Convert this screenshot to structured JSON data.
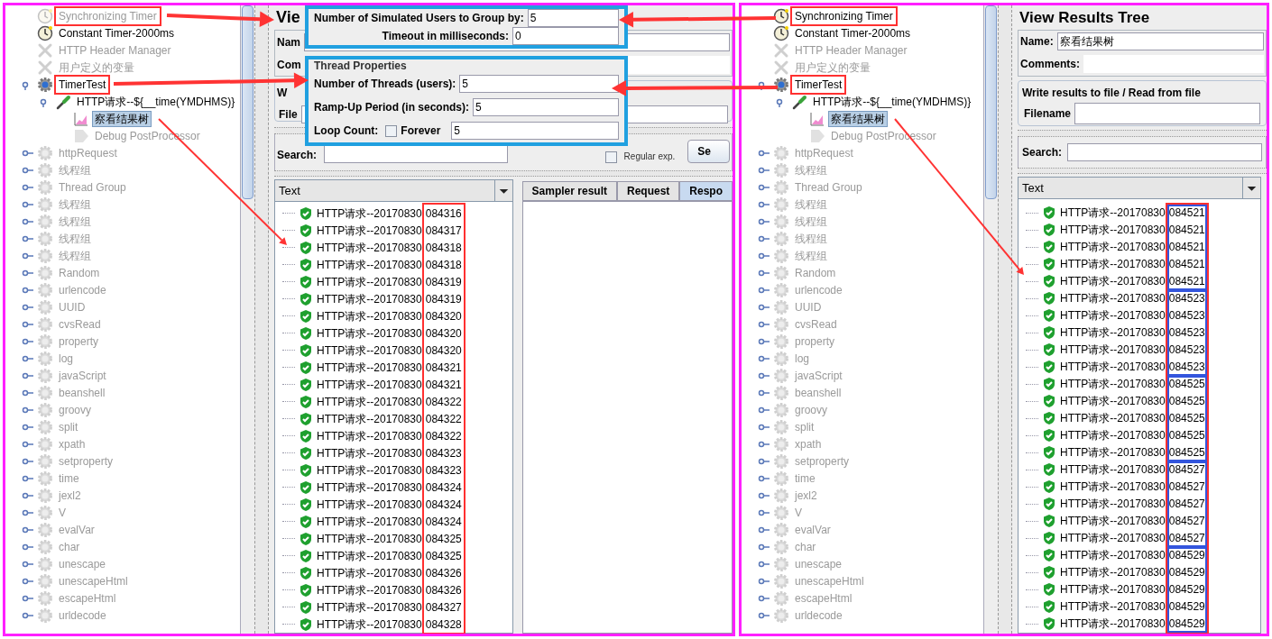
{
  "left_screenshot": {
    "tree": [
      {
        "label": "Synchronizing Timer",
        "kind": "timer",
        "selected": false,
        "disabled": true,
        "highlighted": true
      },
      {
        "label": "Constant Timer-2000ms",
        "kind": "timer",
        "selected": false,
        "disabled": false,
        "highlighted": false
      },
      {
        "label": "HTTP Header Manager",
        "kind": "config",
        "selected": false,
        "disabled": true,
        "highlighted": false
      },
      {
        "label": "用户定义的变量",
        "kind": "config",
        "selected": false,
        "disabled": true,
        "highlighted": false
      },
      {
        "label": "TimerTest",
        "kind": "thread-group",
        "expanded": true,
        "selected": false,
        "disabled": false,
        "highlighted": true,
        "children": [
          {
            "label": "HTTP请求--${__time(YMDHMS)}",
            "kind": "sampler",
            "expanded": true,
            "selected": false,
            "disabled": false,
            "highlighted": false,
            "children": [
              {
                "label": "察看结果树",
                "kind": "listener",
                "selected": true,
                "disabled": false,
                "highlighted": false
              },
              {
                "label": "Debug PostProcessor",
                "kind": "post-processor",
                "selected": false,
                "disabled": true,
                "highlighted": false
              }
            ]
          }
        ]
      },
      {
        "label": "httpRequest",
        "kind": "thread-group",
        "expanded": false,
        "selected": false,
        "disabled": true,
        "highlighted": false
      },
      {
        "label": "线程组",
        "kind": "thread-group",
        "expanded": false,
        "selected": false,
        "disabled": true,
        "highlighted": false
      },
      {
        "label": "Thread Group",
        "kind": "thread-group",
        "expanded": false,
        "selected": false,
        "disabled": true,
        "highlighted": false
      },
      {
        "label": "线程组",
        "kind": "thread-group",
        "expanded": false,
        "selected": false,
        "disabled": true,
        "highlighted": false
      },
      {
        "label": "线程组",
        "kind": "thread-group",
        "expanded": false,
        "selected": false,
        "disabled": true,
        "highlighted": false
      },
      {
        "label": "线程组",
        "kind": "thread-group",
        "expanded": false,
        "selected": false,
        "disabled": true,
        "highlighted": false
      },
      {
        "label": "线程组",
        "kind": "thread-group",
        "expanded": false,
        "selected": false,
        "disabled": true,
        "highlighted": false
      },
      {
        "label": "Random",
        "kind": "thread-group",
        "expanded": false,
        "selected": false,
        "disabled": true,
        "highlighted": false
      },
      {
        "label": "urlencode",
        "kind": "thread-group",
        "expanded": false,
        "selected": false,
        "disabled": true,
        "highlighted": false
      },
      {
        "label": "UUID",
        "kind": "thread-group",
        "expanded": false,
        "selected": false,
        "disabled": true,
        "highlighted": false
      },
      {
        "label": "cvsRead",
        "kind": "thread-group",
        "expanded": false,
        "selected": false,
        "disabled": true,
        "highlighted": false
      },
      {
        "label": "property",
        "kind": "thread-group",
        "expanded": false,
        "selected": false,
        "disabled": true,
        "highlighted": false
      },
      {
        "label": "log",
        "kind": "thread-group",
        "expanded": false,
        "selected": false,
        "disabled": true,
        "highlighted": false
      },
      {
        "label": "javaScript",
        "kind": "thread-group",
        "expanded": false,
        "selected": false,
        "disabled": true,
        "highlighted": false
      },
      {
        "label": "beanshell",
        "kind": "thread-group",
        "expanded": false,
        "selected": false,
        "disabled": true,
        "highlighted": false
      },
      {
        "label": "groovy",
        "kind": "thread-group",
        "expanded": false,
        "selected": false,
        "disabled": true,
        "highlighted": false
      },
      {
        "label": "split",
        "kind": "thread-group",
        "expanded": false,
        "selected": false,
        "disabled": true,
        "highlighted": false
      },
      {
        "label": "xpath",
        "kind": "thread-group",
        "expanded": false,
        "selected": false,
        "disabled": true,
        "highlighted": false
      },
      {
        "label": "setproperty",
        "kind": "thread-group",
        "expanded": false,
        "selected": false,
        "disabled": true,
        "highlighted": false
      },
      {
        "label": "time",
        "kind": "thread-group",
        "expanded": false,
        "selected": false,
        "disabled": true,
        "highlighted": false
      },
      {
        "label": "jexl2",
        "kind": "thread-group",
        "expanded": false,
        "selected": false,
        "disabled": true,
        "highlighted": false
      },
      {
        "label": "V",
        "kind": "thread-group",
        "expanded": false,
        "selected": false,
        "disabled": true,
        "highlighted": false
      },
      {
        "label": "evalVar",
        "kind": "thread-group",
        "expanded": false,
        "selected": false,
        "disabled": true,
        "highlighted": false
      },
      {
        "label": "char",
        "kind": "thread-group",
        "expanded": false,
        "selected": false,
        "disabled": true,
        "highlighted": false
      },
      {
        "label": "unescape",
        "kind": "thread-group",
        "expanded": false,
        "selected": false,
        "disabled": true,
        "highlighted": false
      },
      {
        "label": "unescapeHtml",
        "kind": "thread-group",
        "expanded": false,
        "selected": false,
        "disabled": true,
        "highlighted": false
      },
      {
        "label": "escapeHtml",
        "kind": "thread-group",
        "expanded": false,
        "selected": false,
        "disabled": true,
        "highlighted": false
      },
      {
        "label": "urldecode",
        "kind": "thread-group",
        "expanded": false,
        "selected": false,
        "disabled": true,
        "highlighted": false
      }
    ],
    "results_panel": {
      "title": "Vie",
      "name_label": "Nam",
      "comments_label": "Com",
      "file_group_label": "W",
      "filename_label": "File",
      "search_label": "Search:",
      "regex_label": "Regular exp.",
      "regex_checked": false,
      "search_button": "Se",
      "column_header": "Text",
      "tabs": [
        {
          "label": "Sampler result",
          "selected": false
        },
        {
          "label": "Request",
          "selected": false
        },
        {
          "label": "Respo",
          "selected": true
        }
      ],
      "rows": [
        {
          "label": "HTTP请求--20170830",
          "time": "084316"
        },
        {
          "label": "HTTP请求--20170830",
          "time": "084317"
        },
        {
          "label": "HTTP请求--20170830",
          "time": "084318"
        },
        {
          "label": "HTTP请求--20170830",
          "time": "084318"
        },
        {
          "label": "HTTP请求--20170830",
          "time": "084319"
        },
        {
          "label": "HTTP请求--20170830",
          "time": "084319"
        },
        {
          "label": "HTTP请求--20170830",
          "time": "084320"
        },
        {
          "label": "HTTP请求--20170830",
          "time": "084320"
        },
        {
          "label": "HTTP请求--20170830",
          "time": "084320"
        },
        {
          "label": "HTTP请求--20170830",
          "time": "084321"
        },
        {
          "label": "HTTP请求--20170830",
          "time": "084321"
        },
        {
          "label": "HTTP请求--20170830",
          "time": "084322"
        },
        {
          "label": "HTTP请求--20170830",
          "time": "084322"
        },
        {
          "label": "HTTP请求--20170830",
          "time": "084322"
        },
        {
          "label": "HTTP请求--20170830",
          "time": "084323"
        },
        {
          "label": "HTTP请求--20170830",
          "time": "084323"
        },
        {
          "label": "HTTP请求--20170830",
          "time": "084324"
        },
        {
          "label": "HTTP请求--20170830",
          "time": "084324"
        },
        {
          "label": "HTTP请求--20170830",
          "time": "084324"
        },
        {
          "label": "HTTP请求--20170830",
          "time": "084325"
        },
        {
          "label": "HTTP请求--20170830",
          "time": "084325"
        },
        {
          "label": "HTTP请求--20170830",
          "time": "084326"
        },
        {
          "label": "HTTP请求--20170830",
          "time": "084326"
        },
        {
          "label": "HTTP请求--20170830",
          "time": "084327"
        },
        {
          "label": "HTTP请求--20170830",
          "time": "084328"
        }
      ]
    },
    "overlays": [
      {
        "fields": [
          {
            "kind": "text",
            "label": "Number of Simulated Users to Group by:",
            "value": "5"
          },
          {
            "kind": "text",
            "label": "Timeout in milliseconds:",
            "value": "0"
          }
        ]
      },
      {
        "title": "Thread Properties",
        "fields": [
          {
            "kind": "text",
            "label": "Number of Threads (users):",
            "value": "5"
          },
          {
            "kind": "text",
            "label": "Ramp-Up Period (in seconds):",
            "value": "5"
          },
          {
            "kind": "loop",
            "label": "Loop Count:",
            "checkbox_label": "Forever",
            "checked": false,
            "value": "5"
          }
        ]
      }
    ]
  },
  "right_screenshot": {
    "tree": [
      {
        "label": "Synchronizing Timer",
        "kind": "timer",
        "selected": false,
        "disabled": false,
        "highlighted": true
      },
      {
        "label": "Constant Timer-2000ms",
        "kind": "timer",
        "selected": false,
        "disabled": false,
        "highlighted": false
      },
      {
        "label": "HTTP Header Manager",
        "kind": "config",
        "selected": false,
        "disabled": true,
        "highlighted": false
      },
      {
        "label": "用户定义的变量",
        "kind": "config",
        "selected": false,
        "disabled": true,
        "highlighted": false
      },
      {
        "label": "TimerTest",
        "kind": "thread-group",
        "expanded": true,
        "selected": false,
        "disabled": false,
        "highlighted": true,
        "children": [
          {
            "label": "HTTP请求--${__time(YMDHMS)}",
            "kind": "sampler",
            "expanded": true,
            "selected": false,
            "disabled": false,
            "highlighted": false,
            "children": [
              {
                "label": "察看结果树",
                "kind": "listener",
                "selected": true,
                "disabled": false,
                "highlighted": false
              },
              {
                "label": "Debug PostProcessor",
                "kind": "post-processor",
                "selected": false,
                "disabled": true,
                "highlighted": false
              }
            ]
          }
        ]
      },
      {
        "label": "httpRequest",
        "kind": "thread-group",
        "expanded": false,
        "selected": false,
        "disabled": true,
        "highlighted": false
      },
      {
        "label": "线程组",
        "kind": "thread-group",
        "expanded": false,
        "selected": false,
        "disabled": true,
        "highlighted": false
      },
      {
        "label": "Thread Group",
        "kind": "thread-group",
        "expanded": false,
        "selected": false,
        "disabled": true,
        "highlighted": false
      },
      {
        "label": "线程组",
        "kind": "thread-group",
        "expanded": false,
        "selected": false,
        "disabled": true,
        "highlighted": false
      },
      {
        "label": "线程组",
        "kind": "thread-group",
        "expanded": false,
        "selected": false,
        "disabled": true,
        "highlighted": false
      },
      {
        "label": "线程组",
        "kind": "thread-group",
        "expanded": false,
        "selected": false,
        "disabled": true,
        "highlighted": false
      },
      {
        "label": "线程组",
        "kind": "thread-group",
        "expanded": false,
        "selected": false,
        "disabled": true,
        "highlighted": false
      },
      {
        "label": "Random",
        "kind": "thread-group",
        "expanded": false,
        "selected": false,
        "disabled": true,
        "highlighted": false
      },
      {
        "label": "urlencode",
        "kind": "thread-group",
        "expanded": false,
        "selected": false,
        "disabled": true,
        "highlighted": false
      },
      {
        "label": "UUID",
        "kind": "thread-group",
        "expanded": false,
        "selected": false,
        "disabled": true,
        "highlighted": false
      },
      {
        "label": "cvsRead",
        "kind": "thread-group",
        "expanded": false,
        "selected": false,
        "disabled": true,
        "highlighted": false
      },
      {
        "label": "property",
        "kind": "thread-group",
        "expanded": false,
        "selected": false,
        "disabled": true,
        "highlighted": false
      },
      {
        "label": "log",
        "kind": "thread-group",
        "expanded": false,
        "selected": false,
        "disabled": true,
        "highlighted": false
      },
      {
        "label": "javaScript",
        "kind": "thread-group",
        "expanded": false,
        "selected": false,
        "disabled": true,
        "highlighted": false
      },
      {
        "label": "beanshell",
        "kind": "thread-group",
        "expanded": false,
        "selected": false,
        "disabled": true,
        "highlighted": false
      },
      {
        "label": "groovy",
        "kind": "thread-group",
        "expanded": false,
        "selected": false,
        "disabled": true,
        "highlighted": false
      },
      {
        "label": "split",
        "kind": "thread-group",
        "expanded": false,
        "selected": false,
        "disabled": true,
        "highlighted": false
      },
      {
        "label": "xpath",
        "kind": "thread-group",
        "expanded": false,
        "selected": false,
        "disabled": true,
        "highlighted": false
      },
      {
        "label": "setproperty",
        "kind": "thread-group",
        "expanded": false,
        "selected": false,
        "disabled": true,
        "highlighted": false
      },
      {
        "label": "time",
        "kind": "thread-group",
        "expanded": false,
        "selected": false,
        "disabled": true,
        "highlighted": false
      },
      {
        "label": "jexl2",
        "kind": "thread-group",
        "expanded": false,
        "selected": false,
        "disabled": true,
        "highlighted": false
      },
      {
        "label": "V",
        "kind": "thread-group",
        "expanded": false,
        "selected": false,
        "disabled": true,
        "highlighted": false
      },
      {
        "label": "evalVar",
        "kind": "thread-group",
        "expanded": false,
        "selected": false,
        "disabled": true,
        "highlighted": false
      },
      {
        "label": "char",
        "kind": "thread-group",
        "expanded": false,
        "selected": false,
        "disabled": true,
        "highlighted": false
      },
      {
        "label": "unescape",
        "kind": "thread-group",
        "expanded": false,
        "selected": false,
        "disabled": true,
        "highlighted": false
      },
      {
        "label": "unescapeHtml",
        "kind": "thread-group",
        "expanded": false,
        "selected": false,
        "disabled": true,
        "highlighted": false
      },
      {
        "label": "escapeHtml",
        "kind": "thread-group",
        "expanded": false,
        "selected": false,
        "disabled": true,
        "highlighted": false
      },
      {
        "label": "urldecode",
        "kind": "thread-group",
        "expanded": false,
        "selected": false,
        "disabled": true,
        "highlighted": false
      }
    ],
    "results_panel": {
      "title": "View Results Tree",
      "name_label": "Name:",
      "name_value": "察看结果树",
      "comments_label": "Comments:",
      "file_group_label": "Write results to file / Read from file",
      "filename_label": "Filename",
      "search_label": "Search:",
      "column_header": "Text",
      "result_groups": [
        {
          "rows": [
            {
              "label": "HTTP请求--20170830",
              "time": "084521"
            },
            {
              "label": "HTTP请求--20170830",
              "time": "084521"
            },
            {
              "label": "HTTP请求--20170830",
              "time": "084521"
            },
            {
              "label": "HTTP请求--20170830",
              "time": "084521"
            },
            {
              "label": "HTTP请求--20170830",
              "time": "084521"
            }
          ]
        },
        {
          "rows": [
            {
              "label": "HTTP请求--20170830",
              "time": "084523"
            },
            {
              "label": "HTTP请求--20170830",
              "time": "084523"
            },
            {
              "label": "HTTP请求--20170830",
              "time": "084523"
            },
            {
              "label": "HTTP请求--20170830",
              "time": "084523"
            },
            {
              "label": "HTTP请求--20170830",
              "time": "084523"
            }
          ]
        },
        {
          "rows": [
            {
              "label": "HTTP请求--20170830",
              "time": "084525"
            },
            {
              "label": "HTTP请求--20170830",
              "time": "084525"
            },
            {
              "label": "HTTP请求--20170830",
              "time": "084525"
            },
            {
              "label": "HTTP请求--20170830",
              "time": "084525"
            },
            {
              "label": "HTTP请求--20170830",
              "time": "084525"
            }
          ]
        },
        {
          "rows": [
            {
              "label": "HTTP请求--20170830",
              "time": "084527"
            },
            {
              "label": "HTTP请求--20170830",
              "time": "084527"
            },
            {
              "label": "HTTP请求--20170830",
              "time": "084527"
            },
            {
              "label": "HTTP请求--20170830",
              "time": "084527"
            },
            {
              "label": "HTTP请求--20170830",
              "time": "084527"
            }
          ]
        },
        {
          "rows": [
            {
              "label": "HTTP请求--20170830",
              "time": "084529"
            },
            {
              "label": "HTTP请求--20170830",
              "time": "084529"
            },
            {
              "label": "HTTP请求--20170830",
              "time": "084529"
            },
            {
              "label": "HTTP请求--20170830",
              "time": "084529"
            },
            {
              "label": "HTTP请求--20170830",
              "time": "084529"
            }
          ]
        }
      ]
    }
  }
}
